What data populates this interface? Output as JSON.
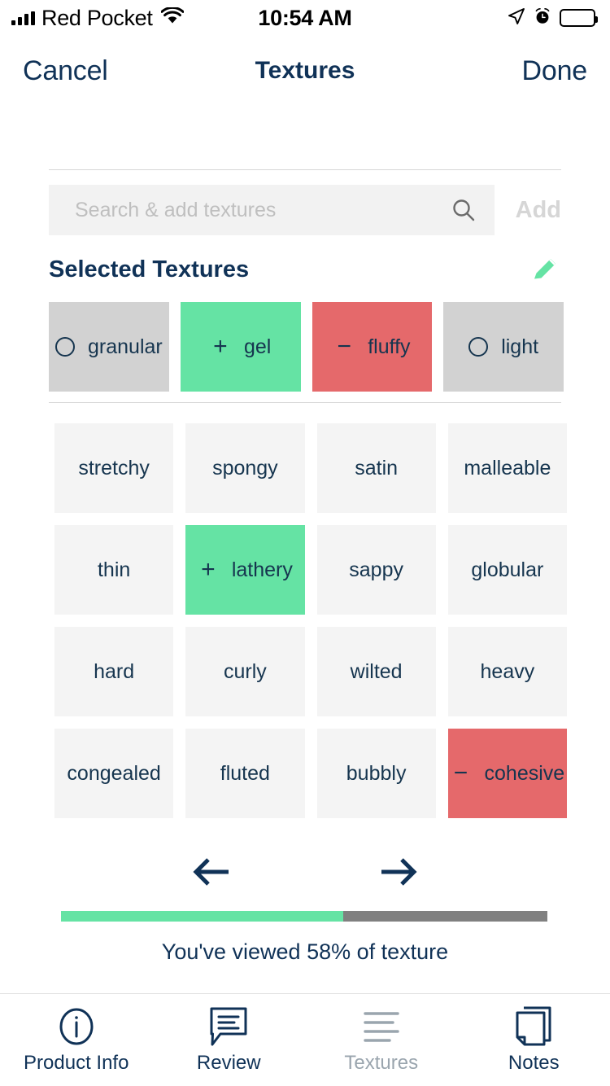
{
  "status_bar": {
    "carrier": "Red Pocket",
    "time": "10:54 AM",
    "signal_icon": "cellular-bars-icon",
    "wifi_icon": "wifi-icon",
    "location_icon": "location-arrow-icon",
    "alarm_icon": "alarm-clock-icon",
    "battery_icon": "battery-full-icon"
  },
  "nav_bar": {
    "cancel_label": "Cancel",
    "title": "Textures",
    "done_label": "Done"
  },
  "search": {
    "placeholder": "Search & add textures",
    "value": "",
    "search_icon": "search-icon",
    "add_label": "Add"
  },
  "selected_section": {
    "title": "Selected Textures",
    "edit_icon": "pencil-edit-icon",
    "items": [
      {
        "label": "granular",
        "state": "neutral",
        "mark": "circle"
      },
      {
        "label": "gel",
        "state": "pos",
        "mark": "+"
      },
      {
        "label": "fluffy",
        "state": "neg",
        "mark": "−"
      },
      {
        "label": "light",
        "state": "neutral",
        "mark": "circle"
      }
    ]
  },
  "grid": {
    "tiles": [
      {
        "label": "stretchy",
        "state": "none",
        "mark": ""
      },
      {
        "label": "spongy",
        "state": "none",
        "mark": ""
      },
      {
        "label": "satin",
        "state": "none",
        "mark": ""
      },
      {
        "label": "malleable",
        "state": "none",
        "mark": ""
      },
      {
        "label": "thin",
        "state": "none",
        "mark": ""
      },
      {
        "label": "lathery",
        "state": "pos",
        "mark": "+"
      },
      {
        "label": "sappy",
        "state": "none",
        "mark": ""
      },
      {
        "label": "globular",
        "state": "none",
        "mark": ""
      },
      {
        "label": "hard",
        "state": "none",
        "mark": ""
      },
      {
        "label": "curly",
        "state": "none",
        "mark": ""
      },
      {
        "label": "wilted",
        "state": "none",
        "mark": ""
      },
      {
        "label": "heavy",
        "state": "none",
        "mark": ""
      },
      {
        "label": "congealed",
        "state": "none",
        "mark": ""
      },
      {
        "label": "fluted",
        "state": "none",
        "mark": ""
      },
      {
        "label": "bubbly",
        "state": "none",
        "mark": ""
      },
      {
        "label": "cohesive",
        "state": "neg",
        "mark": "−"
      }
    ]
  },
  "pager": {
    "prev_icon": "arrow-left-icon",
    "next_icon": "arrow-right-icon"
  },
  "progress": {
    "percent": 58,
    "text": "You've viewed 58% of texture",
    "fill_color": "#65e3a4",
    "track_color": "#808080"
  },
  "tab_bar": {
    "tabs": [
      {
        "label": "Product Info",
        "icon": "info-circle-icon",
        "active": true
      },
      {
        "label": "Review",
        "icon": "speech-bubble-icon",
        "active": true
      },
      {
        "label": "Textures",
        "icon": "lines-icon",
        "active": false
      },
      {
        "label": "Notes",
        "icon": "notes-pages-icon",
        "active": true
      }
    ]
  },
  "colors": {
    "navy": "#103257",
    "green": "#65e3a4",
    "red": "#e5696b",
    "gray_selected": "#d2d2d2",
    "tile_bg": "#f4f4f4"
  }
}
